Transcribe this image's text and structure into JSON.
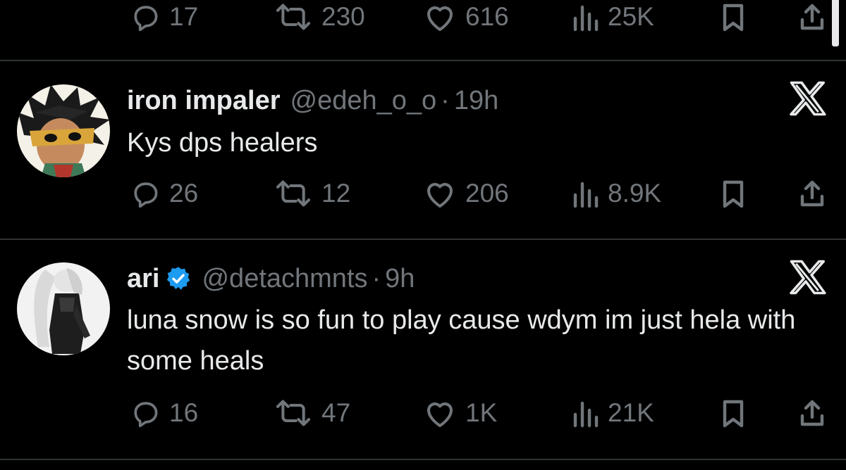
{
  "top_tweet": {
    "actions": {
      "replies": "17",
      "reposts": "230",
      "likes": "616",
      "views": "25K"
    }
  },
  "tweets": [
    {
      "display_name": "iron impaler",
      "verified": false,
      "handle": "@edeh_o_o",
      "separator": "·",
      "time": "19h",
      "text": "Kys dps healers",
      "actions": {
        "replies": "26",
        "reposts": "12",
        "likes": "206",
        "views": "8.9K"
      }
    },
    {
      "display_name": "ari",
      "verified": true,
      "handle": "@detachmnts",
      "separator": "·",
      "time": "9h",
      "text": "luna snow is so fun to play cause wdym im just hela with some heals",
      "actions": {
        "replies": "16",
        "reposts": "47",
        "likes": "1K",
        "views": "21K"
      }
    }
  ],
  "colors": {
    "background": "#000000",
    "text": "#e7e9ea",
    "muted": "#71767b",
    "divider": "#2f3336",
    "verified": "#1d9bf0"
  }
}
